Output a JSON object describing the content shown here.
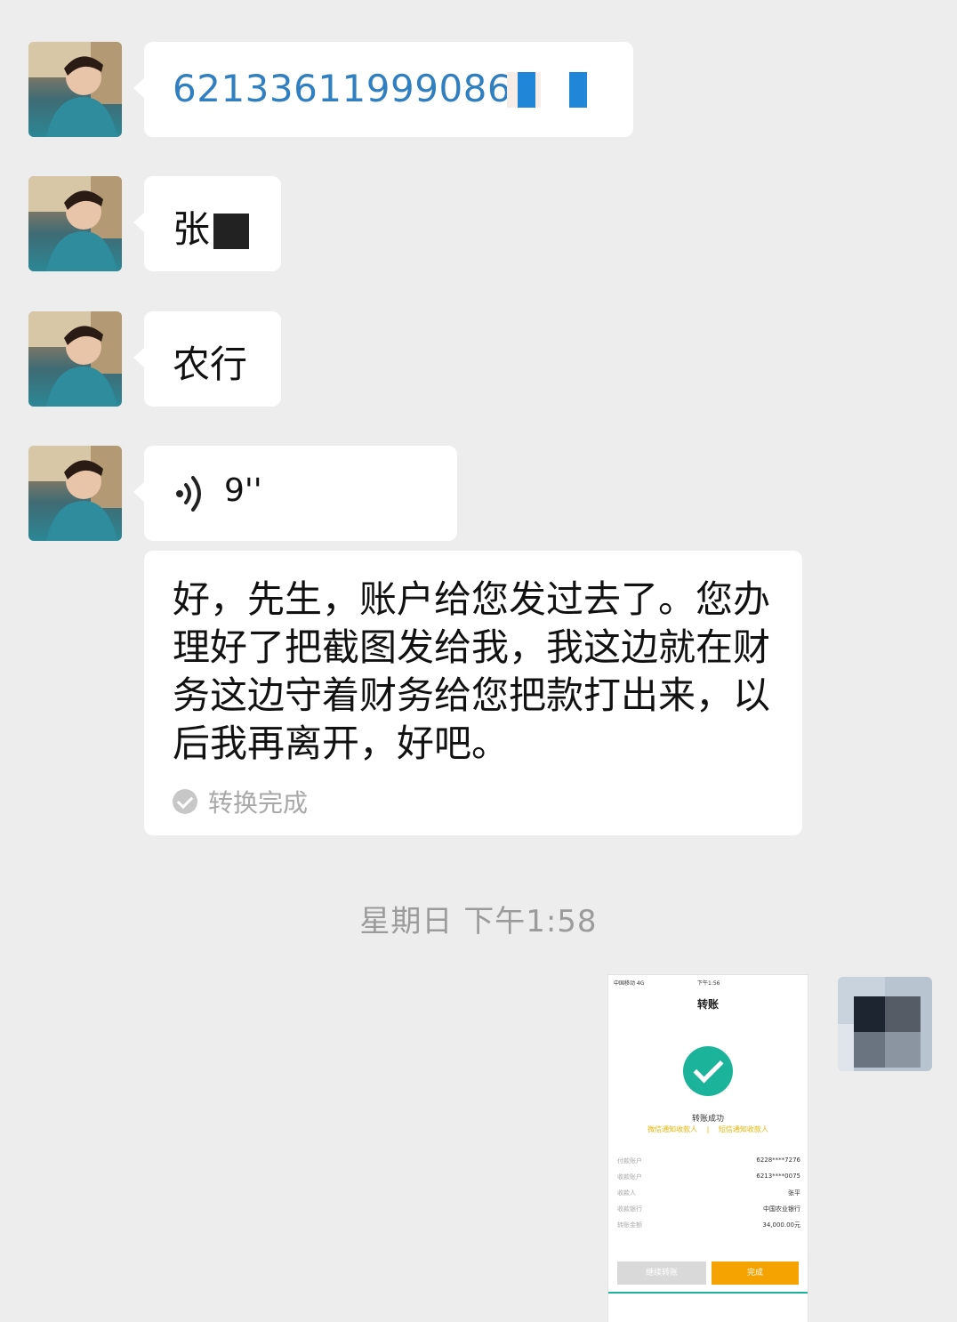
{
  "messages": {
    "account_number": "62133611999086",
    "account_partial_digit": "6",
    "name_visible": "张",
    "bank": "农行",
    "voice_duration": "9''",
    "long_text": "好，先生，账户给您发过去了。您办理好了把截图发给我，我这边就在财务这边守着财务给您把款打出来，以后我再离开，好吧。",
    "convert_status": "转换完成"
  },
  "timestamp": "星期日 下午1:58",
  "screenshot": {
    "carrier": "中国移动 4G",
    "time": "下午1:56",
    "title": "转账",
    "result": "转账成功",
    "link_wechat": "微信通知收款人",
    "link_separator": "|",
    "link_sms": "短信通知收款人",
    "fields": [
      {
        "label": "付款账户",
        "value": "6228****7276"
      },
      {
        "label": "收款账户",
        "value": "6213****0075"
      },
      {
        "label": "收款人",
        "value": "张平"
      },
      {
        "label": "收款银行",
        "value": "中国农业银行"
      },
      {
        "label": "转账金额",
        "value": "34,000.00元"
      }
    ],
    "btn_continue": "继续转账",
    "btn_done": "完成"
  },
  "colors": {
    "background": "#ededed",
    "link_blue": "#2f7fc1",
    "success_green": "#1bb39a",
    "orange": "#f5a300"
  },
  "icons": {
    "voice": "voice-wave-icon",
    "check": "check-circle-icon"
  }
}
